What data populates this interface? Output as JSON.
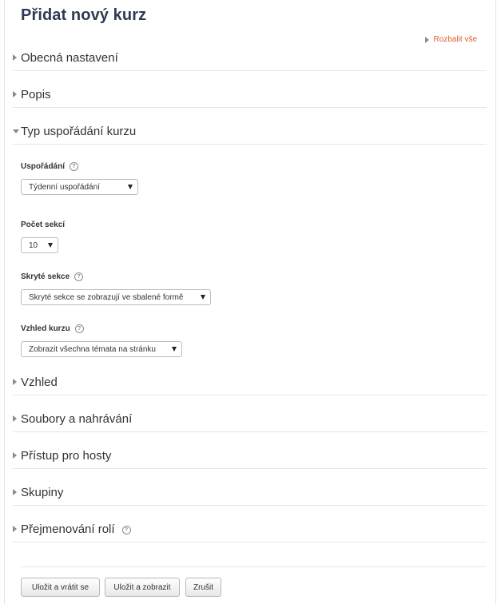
{
  "page": {
    "title": "Přidat nový kurz",
    "expand_all": "Rozbalit vše"
  },
  "sections": [
    {
      "label": "Obecná nastavení",
      "expanded": false
    },
    {
      "label": "Popis",
      "expanded": false
    },
    {
      "label": "Typ uspořádání kurzu",
      "expanded": true
    },
    {
      "label": "Vzhled",
      "expanded": false
    },
    {
      "label": "Soubory a nahrávání",
      "expanded": false
    },
    {
      "label": "Přístup pro hosty",
      "expanded": false
    },
    {
      "label": "Skupiny",
      "expanded": false
    },
    {
      "label": "Přejmenování rolí",
      "expanded": false,
      "help": true
    }
  ],
  "format": {
    "layout_label": "Uspořádání",
    "layout_value": "Týdenní uspořádání",
    "sections_count_label": "Počet sekcí",
    "sections_count_value": "10",
    "hidden_sections_label": "Skryté sekce",
    "hidden_sections_value": "Skryté sekce se zobrazují ve sbalené formě",
    "course_layout_label": "Vzhled kurzu",
    "course_layout_value": "Zobrazit všechna témata na stránku"
  },
  "buttons": {
    "save_return": "Uložit a vrátit se",
    "save_display": "Uložit a zobrazit",
    "cancel": "Zrušit"
  },
  "icons": {
    "collapsed": "triangle-right-icon",
    "expanded": "triangle-down-icon",
    "help": "help-icon"
  },
  "colors": {
    "title": "#2f3a52",
    "link": "#e0602c"
  }
}
